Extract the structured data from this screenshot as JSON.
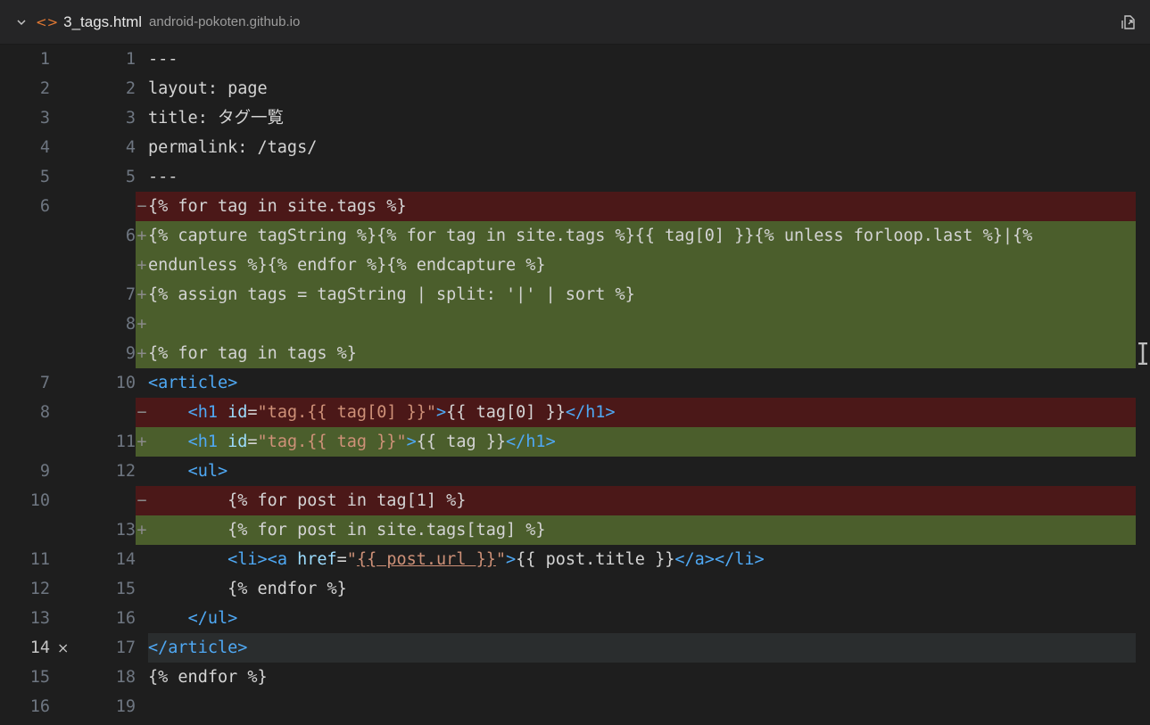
{
  "header": {
    "filename": "3_tags.html",
    "path": "android-pokoten.github.io"
  },
  "rows": [
    {
      "l": "1",
      "r": "1",
      "s": "",
      "k": "ctx",
      "c": "---"
    },
    {
      "l": "2",
      "r": "2",
      "s": "",
      "k": "ctx",
      "c": "layout: page"
    },
    {
      "l": "3",
      "r": "3",
      "s": "",
      "k": "ctx",
      "c": "title: タグ一覧"
    },
    {
      "l": "4",
      "r": "4",
      "s": "",
      "k": "ctx",
      "c": "permalink: /tags/"
    },
    {
      "l": "5",
      "r": "5",
      "s": "",
      "k": "ctx",
      "c": "---"
    },
    {
      "l": "6",
      "r": "",
      "s": "−",
      "k": "del",
      "c": "{% for tag in site.tags %}"
    },
    {
      "l": "",
      "r": "6",
      "s": "+",
      "k": "add",
      "c": "{% capture tagString %}{% for tag in site.tags %}{{ tag[0] }}{% unless forloop.last %}|{%"
    },
    {
      "l": "",
      "r": "",
      "s": "+",
      "k": "add",
      "c": "endunless %}{% endfor %}{% endcapture %}"
    },
    {
      "l": "",
      "r": "7",
      "s": "+",
      "k": "add",
      "c": "{% assign tags = tagString | split: '|' | sort %}"
    },
    {
      "l": "",
      "r": "8",
      "s": "+",
      "k": "add",
      "c": ""
    },
    {
      "l": "",
      "r": "9",
      "s": "+",
      "k": "add",
      "c": "{% for tag in tags %}"
    },
    {
      "l": "7",
      "r": "10",
      "s": "",
      "k": "ctx",
      "c": "<article>"
    },
    {
      "l": "8",
      "r": "",
      "s": "−",
      "k": "del",
      "c": "    <h1 id=\"tag.{{ tag[0] }}\">{{ tag[0] }}</h1>"
    },
    {
      "l": "",
      "r": "11",
      "s": "+",
      "k": "add",
      "c": "    <h1 id=\"tag.{{ tag }}\">{{ tag }}</h1>"
    },
    {
      "l": "9",
      "r": "12",
      "s": "",
      "k": "ctx",
      "c": "    <ul>"
    },
    {
      "l": "10",
      "r": "",
      "s": "−",
      "k": "del",
      "c": "        {% for post in tag[1] %}"
    },
    {
      "l": "",
      "r": "13",
      "s": "+",
      "k": "add",
      "c": "        {% for post in site.tags[tag] %}"
    },
    {
      "l": "11",
      "r": "14",
      "s": "",
      "k": "ctx",
      "c": "        <li><a href=\"{{ post.url }}\">{{ post.title }}</a></li>"
    },
    {
      "l": "12",
      "r": "15",
      "s": "",
      "k": "ctx",
      "c": "        {% endfor %}"
    },
    {
      "l": "13",
      "r": "16",
      "s": "",
      "k": "ctx",
      "c": "    </ul>"
    },
    {
      "l": "14",
      "r": "17",
      "s": "",
      "k": "active",
      "c": "</article>"
    },
    {
      "l": "15",
      "r": "18",
      "s": "",
      "k": "ctx",
      "c": "{% endfor %}"
    },
    {
      "l": "16",
      "r": "19",
      "s": "",
      "k": "ctx",
      "c": ""
    }
  ],
  "colors": {
    "deleted_line": "#4b1818",
    "added_line": "#4b5e2c",
    "deleted_word": "#a21d1d",
    "added_word": "#6c8a34",
    "tag": "#4fa9f5",
    "string": "#ce9178"
  },
  "icons": {
    "collapse": "chevron-down-icon",
    "file": "html-file-icon",
    "open": "open-file-icon",
    "fold": "fold-icon"
  }
}
